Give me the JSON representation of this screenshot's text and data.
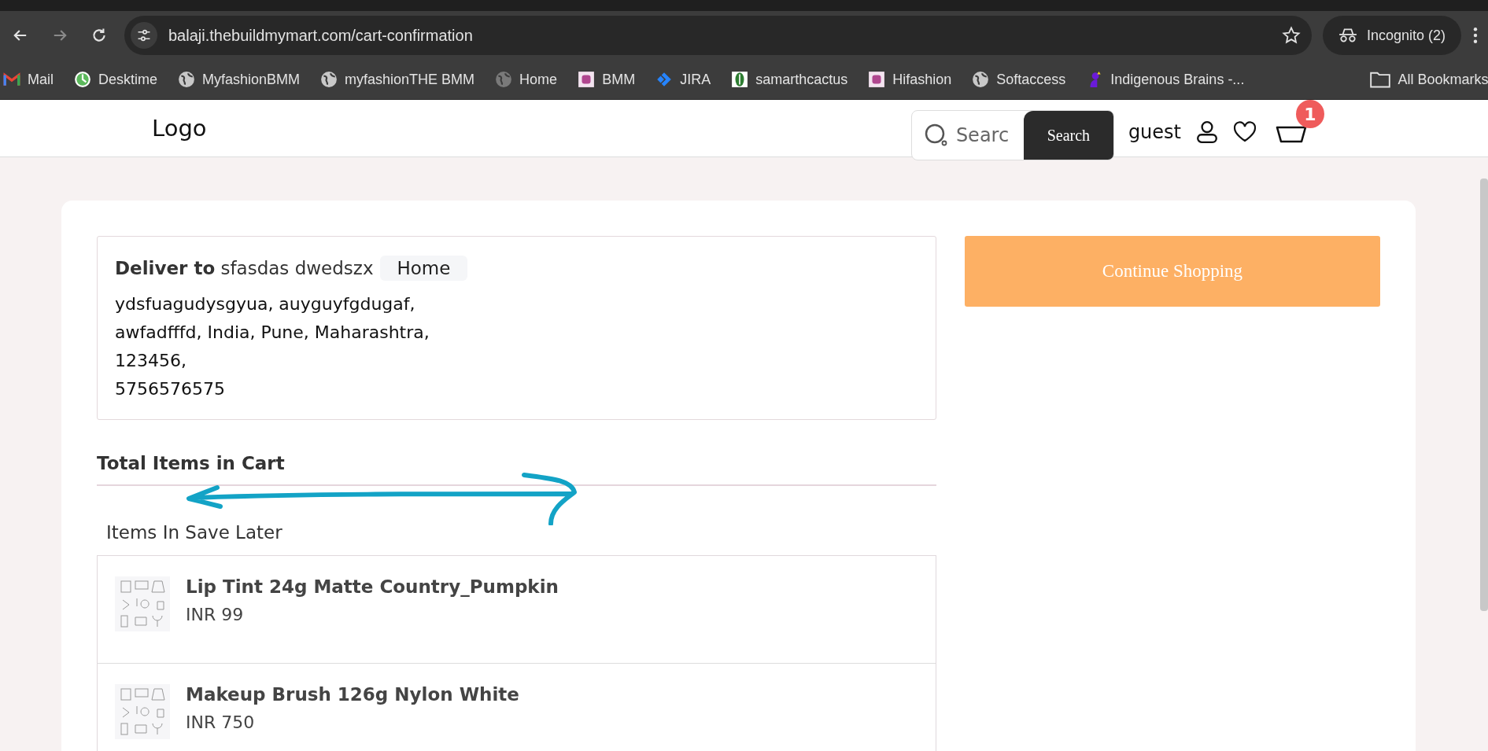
{
  "browser": {
    "url": "balaji.thebuildmymart.com/cart-confirmation",
    "incognito_label": "Incognito (2)",
    "bookmarks": [
      {
        "label": "Mail",
        "kind": "mail"
      },
      {
        "label": "Desktime",
        "kind": "clock"
      },
      {
        "label": "MyfashionBMM",
        "kind": "globe"
      },
      {
        "label": "myfashionTHE BMM",
        "kind": "globe"
      },
      {
        "label": "Home",
        "kind": "globe-dim"
      },
      {
        "label": "BMM",
        "kind": "thumbnail"
      },
      {
        "label": "JIRA",
        "kind": "jira"
      },
      {
        "label": "samarthcactus",
        "kind": "leaf"
      },
      {
        "label": "Hifashion",
        "kind": "thumbnail"
      },
      {
        "label": "Softaccess",
        "kind": "globe"
      },
      {
        "label": "Indigenous Brains -...",
        "kind": "figure"
      }
    ],
    "all_bookmarks": "All Bookmarks"
  },
  "header": {
    "logo": "Logo",
    "search_placeholder": "Searc",
    "search_button": "Search",
    "user_label": "guest",
    "cart_count": "1"
  },
  "delivery": {
    "label": "Deliver to",
    "name": "sfasdas dwedszx",
    "address_type": "Home",
    "address_lines": [
      "ydsfuagudysgyua, auyguyfgdugaf,",
      "awfadfffd, India, Pune, Maharashtra,",
      "123456,",
      "5756576575"
    ]
  },
  "continue_button": "Continue Shopping",
  "cart_title": "Total Items in Cart",
  "save_later_title": "Items In Save Later",
  "saved_items": [
    {
      "name": "Lip Tint 24g Matte Country_Pumpkin",
      "price": "INR 99"
    },
    {
      "name": "Makeup Brush 126g Nylon White",
      "price": "INR 750"
    }
  ]
}
